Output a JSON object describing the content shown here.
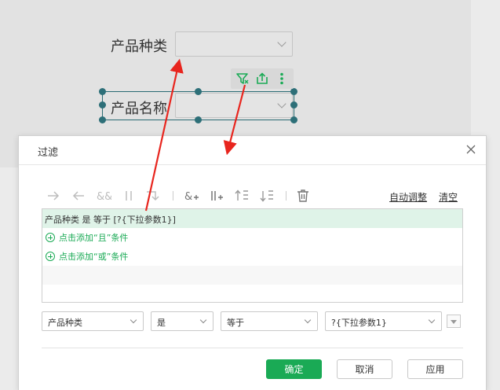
{
  "background": {
    "label_category": "产品种类",
    "label_name": "产品名称"
  },
  "dialog": {
    "title": "过滤",
    "links": {
      "auto_adjust": "自动调整",
      "clear": "清空"
    },
    "condition_text": "产品种类 是 等于 [?{下拉参数1}]",
    "add_and": "点击添加“且”条件",
    "add_or": "点击添加“或”条件",
    "editor": {
      "field": "产品种类",
      "relation": "是",
      "operator": "等于",
      "value": "?{下拉参数1}"
    },
    "buttons": {
      "ok": "确定",
      "cancel": "取消",
      "apply": "应用"
    }
  },
  "colors": {
    "accent": "#1aaa55",
    "selection_frame": "#2a6b73",
    "annotation_arrow": "#e8251e"
  },
  "icons": [
    "filter-icon",
    "export-icon",
    "more-vertical-icon",
    "close-icon",
    "arrow-right-icon",
    "arrow-left-icon",
    "and-icon",
    "or-icon",
    "wrap-icon",
    "add-and-icon",
    "add-or-icon",
    "move-up-icon",
    "move-down-icon",
    "delete-icon"
  ]
}
